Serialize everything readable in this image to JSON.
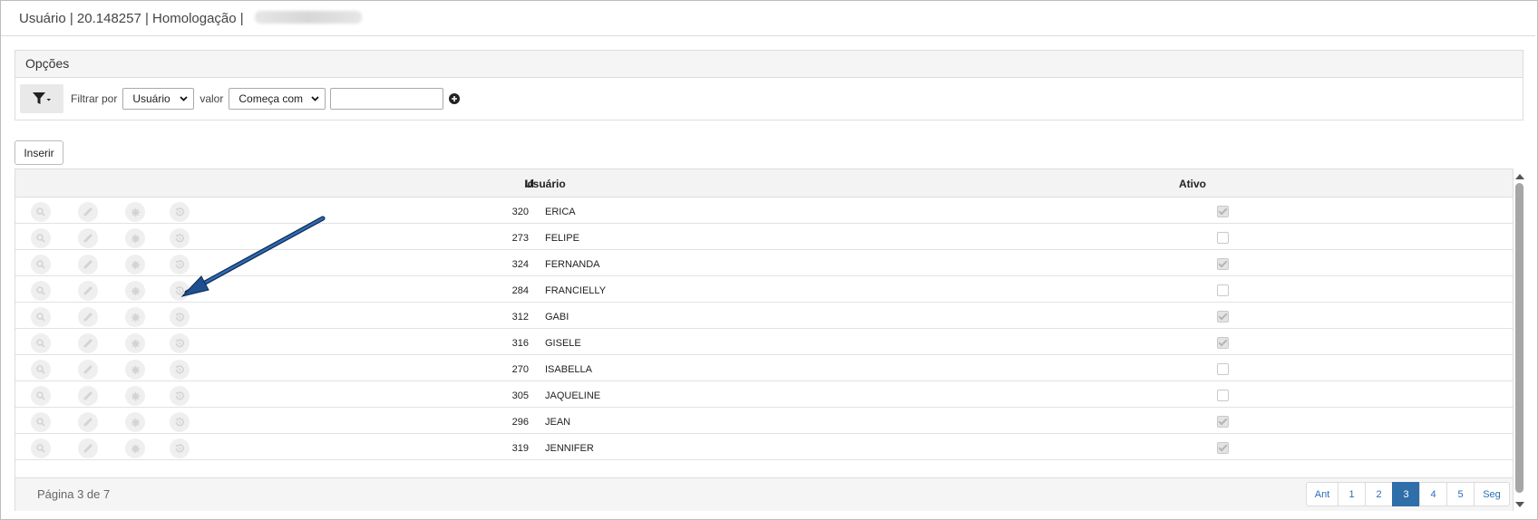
{
  "title": {
    "text": "Usuário | 20.148257 | Homologação | "
  },
  "options": {
    "heading": "Opções",
    "filter_by_label": "Filtrar por",
    "field_select_value": "Usuário",
    "value_label": "valor",
    "condition_select_value": "Começa com",
    "value_input": "",
    "icons": [
      "filter-icon",
      "plus-circle-icon"
    ]
  },
  "toolbar": {
    "insert_label": "Inserir"
  },
  "grid": {
    "columns": {
      "id": "Id",
      "user": "Usuário",
      "active": "Ativo"
    },
    "row_action_icons": [
      "search-icon",
      "edit-icon",
      "gear-icon",
      "history-icon"
    ],
    "rows": [
      {
        "id": "320",
        "user": "ERICA",
        "active": true
      },
      {
        "id": "273",
        "user": "FELIPE",
        "active": false
      },
      {
        "id": "324",
        "user": "FERNANDA",
        "active": true
      },
      {
        "id": "284",
        "user": "FRANCIELLY",
        "active": false
      },
      {
        "id": "312",
        "user": "GABI",
        "active": true
      },
      {
        "id": "316",
        "user": "GISELE",
        "active": true
      },
      {
        "id": "270",
        "user": "ISABELLA",
        "active": false
      },
      {
        "id": "305",
        "user": "JAQUELINE",
        "active": false
      },
      {
        "id": "296",
        "user": "JEAN",
        "active": true
      },
      {
        "id": "319",
        "user": "JENNIFER",
        "active": true
      }
    ]
  },
  "pagination": {
    "info": "Página 3 de 7",
    "prev": "Ant",
    "next": "Seg",
    "pages": [
      "1",
      "2",
      "3",
      "4",
      "5"
    ],
    "current": "3"
  },
  "colors": {
    "accent": "#2f6ea9",
    "annotation_arrow": "#1f4f8f"
  }
}
